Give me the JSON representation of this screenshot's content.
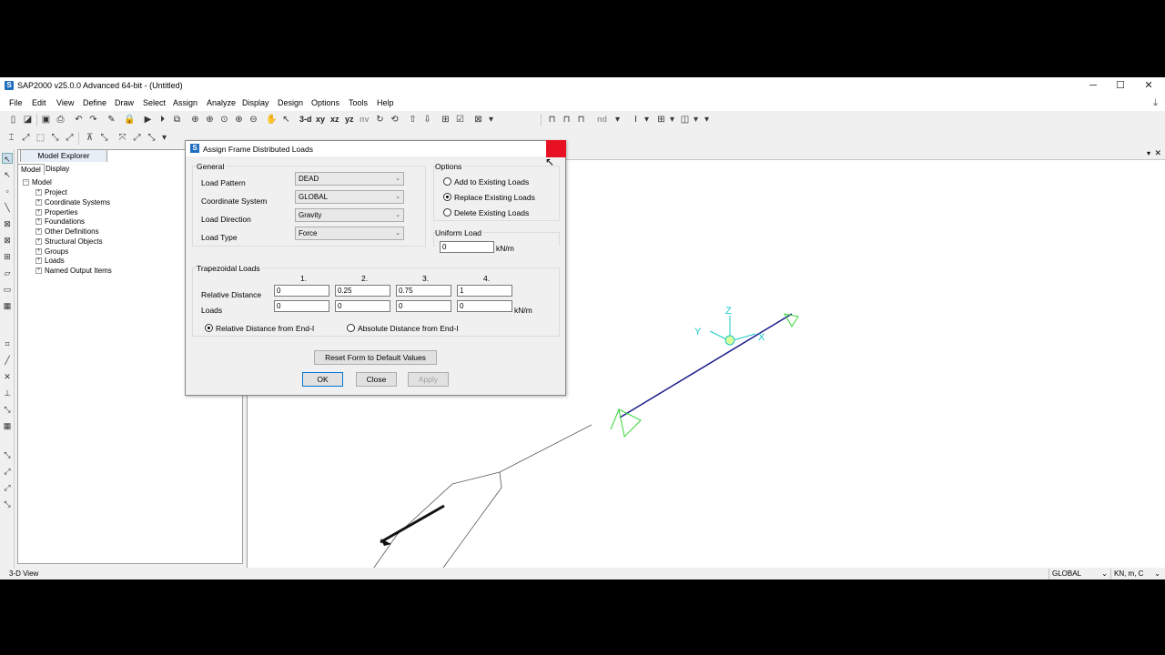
{
  "app": {
    "title": "SAP2000 v25.0.0 Advanced 64-bit - (Untitled)",
    "logo": "S",
    "minimize": "─",
    "maximize": "☐",
    "close": "✕"
  },
  "menu": [
    "File",
    "Edit",
    "View",
    "Define",
    "Draw",
    "Select",
    "Assign",
    "Analyze",
    "Display",
    "Design",
    "Options",
    "Tools",
    "Help"
  ],
  "toolbar": {
    "view_3d": "3-d",
    "view_xy": "xy",
    "view_xz": "xz",
    "view_yz": "yz",
    "view_nv": "nv",
    "nd": "nd"
  },
  "explorer": {
    "title": "Model Explorer",
    "tabs": [
      "Model",
      "Display"
    ],
    "root": "Model",
    "items": [
      "Project",
      "Coordinate Systems",
      "Properties",
      "Foundations",
      "Other Definitions",
      "Structural Objects",
      "Groups",
      "Loads",
      "Named Output Items"
    ]
  },
  "dialog": {
    "title": "Assign Frame Distributed Loads",
    "general": {
      "label": "General",
      "load_pattern_label": "Load Pattern",
      "load_pattern": "DEAD",
      "coord_system_label": "Coordinate System",
      "coord_system": "GLOBAL",
      "load_direction_label": "Load Direction",
      "load_direction": "Gravity",
      "load_type_label": "Load Type",
      "load_type": "Force"
    },
    "options": {
      "label": "Options",
      "add": "Add to Existing Loads",
      "replace": "Replace Existing Loads",
      "delete": "Delete Existing Loads",
      "selected": "replace"
    },
    "uniform": {
      "label": "Uniform Load",
      "value": "0",
      "unit": "kN/m"
    },
    "trapezoidal": {
      "label": "Trapezoidal Loads",
      "columns": [
        "1.",
        "2.",
        "3.",
        "4."
      ],
      "rel_dist_label": "Relative Distance",
      "rel_dist": [
        "0",
        "0.25",
        "0.75",
        "1"
      ],
      "loads_label": "Loads",
      "loads": [
        "0",
        "0",
        "0",
        "0"
      ],
      "unit": "kN/m",
      "relative_option": "Relative Distance from End-I",
      "absolute_option": "Absolute Distance from End-I",
      "selected": "relative"
    },
    "reset_label": "Reset Form to Default Values",
    "ok_label": "OK",
    "close_label": "Close",
    "apply_label": "Apply"
  },
  "canvas": {
    "axis_x": "X",
    "axis_y": "Y",
    "axis_z": "Z",
    "frame_color": "#1a1a8c",
    "support_color": "#39d639",
    "axis_color": "#19c8c8"
  },
  "status": {
    "view": "3-D View",
    "coord": "GLOBAL",
    "units": "KN, m, C"
  },
  "colors": {
    "accent": "#0078d7",
    "close_red": "#e81123",
    "logo_blue": "#1f6fbf"
  }
}
